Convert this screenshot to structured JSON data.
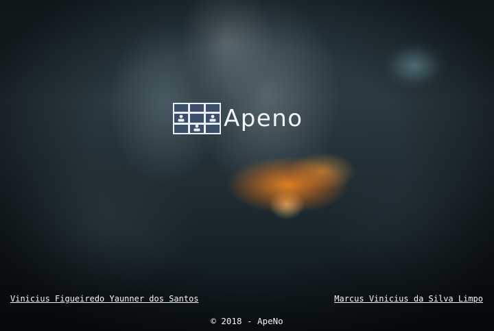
{
  "brand": {
    "name": "Apeno",
    "logo_icon": "people-grid-logo-icon"
  },
  "footer": {
    "credit_left": "Vinicius Figueiredo Yaunner dos Santos",
    "credit_right": "Marcus Vinicius da Silva Limpo",
    "copyright": "© 2018 - ApeNo"
  },
  "colors": {
    "text": "#f3f3f3",
    "logo_tile": "#3b4f6b",
    "logo_frame": "#e9eef2"
  }
}
